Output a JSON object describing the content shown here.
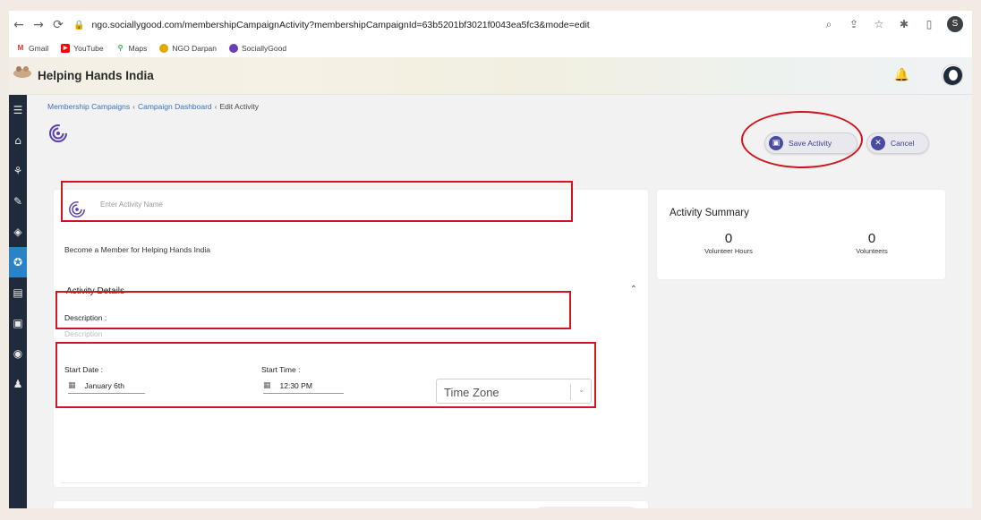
{
  "browser": {
    "url": "ngo.sociallygood.com/membershipCampaignActivity?membershipCampaignId=63b5201bf3021f0043ea5fc3&mode=edit",
    "profile_initial": "S",
    "bookmarks": [
      {
        "label": "Gmail",
        "icon": "gmail-icon",
        "color": "#d93025",
        "glyph": "M"
      },
      {
        "label": "YouTube",
        "icon": "youtube-icon",
        "color": "#ff0000",
        "glyph": "▶"
      },
      {
        "label": "Maps",
        "icon": "maps-icon",
        "color": "#34a853",
        "glyph": "⚲"
      },
      {
        "label": "NGO Darpan",
        "icon": "ngo-darpan-icon",
        "color": "#e0a800",
        "glyph": "●"
      },
      {
        "label": "SociallyGood",
        "icon": "sociallygood-icon",
        "color": "#6a3fb5",
        "glyph": "◎"
      }
    ]
  },
  "header": {
    "org_name": "Helping Hands India"
  },
  "breadcrumb": {
    "items": [
      "Membership Campaigns",
      "Campaign Dashboard"
    ],
    "current": "Edit Activity",
    "separator": "‹"
  },
  "actions": {
    "save_label": "Save Activity",
    "cancel_label": "Cancel"
  },
  "form": {
    "activity_name_placeholder": "Enter Activity Name",
    "tagline": "Become a Member for Helping Hands India",
    "section_title": "Activity Details",
    "description_label": "Description :",
    "description_placeholder": "Description",
    "start_date_label": "Start Date :",
    "start_date_value": "January 6th",
    "start_time_label": "Start Time :",
    "start_time_value": "12:30 PM",
    "timezone_placeholder": "Time Zone"
  },
  "summary": {
    "title": "Activity Summary",
    "stats": [
      {
        "value": "0",
        "label": "Volunteer Hours"
      },
      {
        "value": "0",
        "label": "Volunteers"
      }
    ]
  },
  "colors": {
    "sidebar_bg": "#1f2b3a",
    "sidebar_active": "#2a83c6",
    "accent": "#4a4aa0",
    "annotation_red": "#d1141f"
  }
}
